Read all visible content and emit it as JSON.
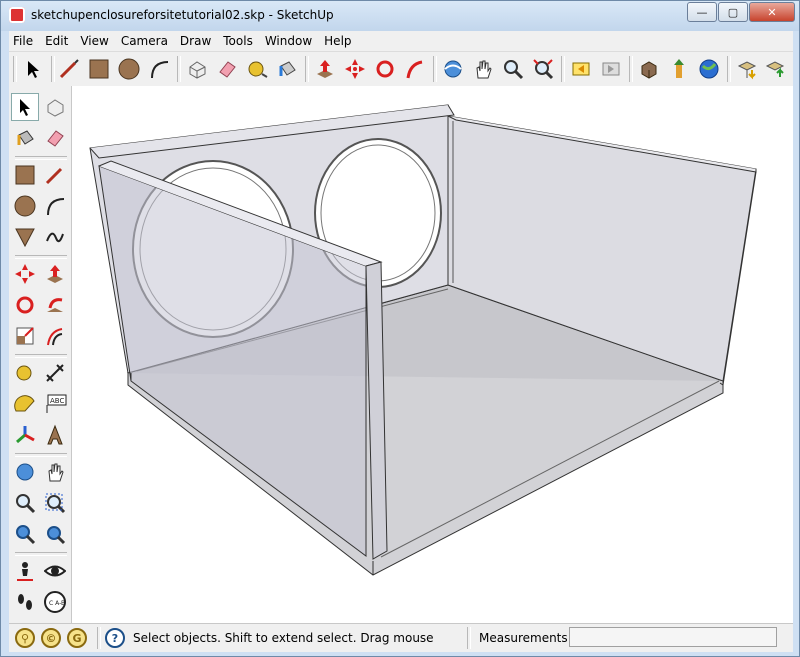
{
  "window": {
    "title": "sketchupenclosureforsitetutorial02.skp - SketchUp"
  },
  "window_controls": {
    "minimize": "—",
    "maximize": "▢",
    "close": "✕"
  },
  "menu": {
    "items": [
      "File",
      "Edit",
      "View",
      "Camera",
      "Draw",
      "Tools",
      "Window",
      "Help"
    ]
  },
  "toolbar_icons": [
    "select-icon",
    "line-icon",
    "rectangle-icon",
    "circle-icon",
    "arc-icon",
    "make-component-icon",
    "eraser-icon",
    "tape-measure-icon",
    "paint-bucket-icon",
    "push-pull-icon",
    "move-icon",
    "rotate-icon",
    "follow-me-icon",
    "orbit-icon",
    "pan-icon",
    "zoom-icon",
    "zoom-extents-icon",
    "previous-view-icon",
    "next-view-icon",
    "get-models-icon",
    "share-model-icon",
    "google-earth-icon",
    "get-current-view-icon",
    "export-icon"
  ],
  "left_toolbar_icons": [
    "select-icon",
    "make-component-icon",
    "paint-bucket-icon",
    "eraser-icon",
    "rectangle-icon",
    "line-icon",
    "circle-icon",
    "arc-icon",
    "polygon-icon",
    "freehand-icon",
    "move-icon",
    "push-pull-icon",
    "rotate-icon",
    "follow-me-icon",
    "scale-icon",
    "offset-icon",
    "tape-measure-icon",
    "dimension-icon",
    "protractor-icon",
    "text-icon",
    "axes-icon",
    "3d-text-icon",
    "orbit-icon",
    "pan-icon",
    "zoom-icon",
    "zoom-window-icon",
    "previous-view-icon",
    "zoom-extents-icon",
    "position-camera-icon",
    "look-around-icon",
    "walk-icon",
    "section-plane-icon"
  ],
  "left_toolbar_text": {
    "text_tool": "ABC",
    "section_plane": "C\nA-B"
  },
  "status": {
    "text": "Select objects. Shift to extend select. Drag mouse",
    "measurements_label": "Measurements",
    "measurements_value": ""
  }
}
